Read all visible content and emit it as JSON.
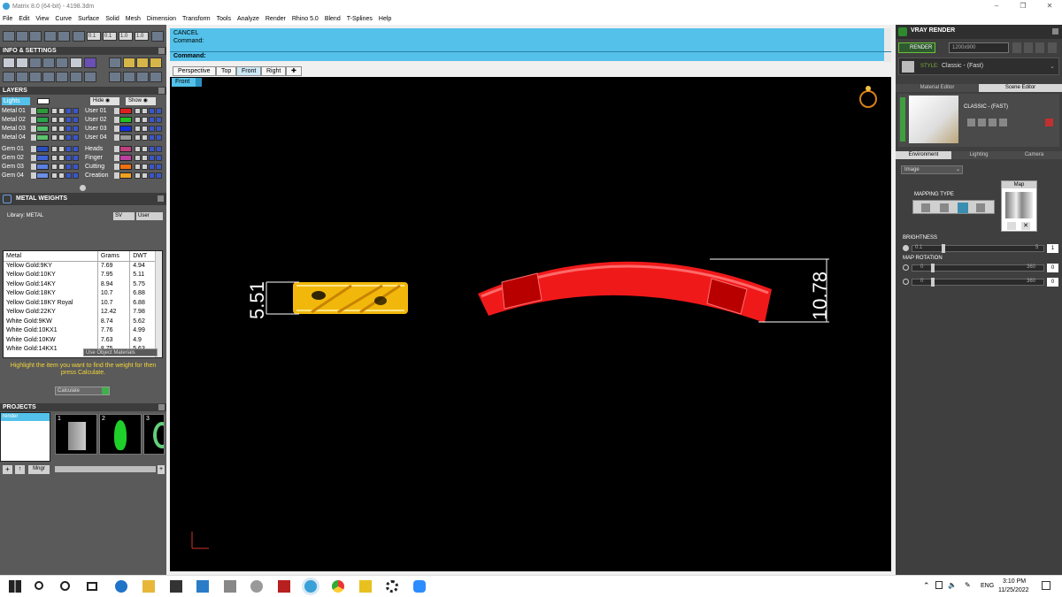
{
  "window": {
    "title": "Matrix 8.0 (64-bit) - 4198.3dm"
  },
  "menu": [
    "File",
    "Edit",
    "View",
    "Curve",
    "Surface",
    "Solid",
    "Mesh",
    "Dimension",
    "Transform",
    "Tools",
    "Analyze",
    "Render",
    "Rhino 5.0",
    "Blend",
    "T-Splines",
    "Help"
  ],
  "toolbar": {
    "values": [
      "0.1",
      "0.1",
      "1.0",
      "1.0"
    ]
  },
  "panels": {
    "info": "INFO & SETTINGS",
    "layers": "LAYERS",
    "metal_weights": "METAL WEIGHTS",
    "projects": "PROJECTS",
    "vray": "VRAY RENDER"
  },
  "layers": {
    "lights": "Lights",
    "hide": "Hide",
    "show": "Show",
    "left": [
      {
        "name": "Metal 01",
        "color": "#2f9a3a"
      },
      {
        "name": "Metal 02",
        "color": "#2aa24a"
      },
      {
        "name": "Metal 03",
        "color": "#52c06a"
      },
      {
        "name": "Metal 04",
        "color": "#5cc46e"
      },
      {
        "name": "Gem 01",
        "color": "#2a4ec0"
      },
      {
        "name": "Gem 02",
        "color": "#3e64d6"
      },
      {
        "name": "Gem 03",
        "color": "#5a80e0"
      },
      {
        "name": "Gem 04",
        "color": "#6d8fe4"
      }
    ],
    "right": [
      {
        "name": "User 01",
        "color": "#e02020"
      },
      {
        "name": "User 02",
        "color": "#22c022"
      },
      {
        "name": "User 03",
        "color": "#1030e0"
      },
      {
        "name": "User 04",
        "color": "#9a9a9a"
      },
      {
        "name": "Heads",
        "color": "#c04080"
      },
      {
        "name": "Finger",
        "color": "#c040a0"
      },
      {
        "name": "Cutting",
        "color": "#f07010"
      },
      {
        "name": "Creation",
        "color": "#f0a020"
      }
    ]
  },
  "metal_weights": {
    "library_label": "Library: METAL",
    "btn_sv": "SV",
    "btn_user": "User",
    "headers": [
      "Metal",
      "Grams",
      "DWT"
    ],
    "rows": [
      [
        "Yellow Gold:9KY",
        "7.69",
        "4.94"
      ],
      [
        "Yellow Gold:10KY",
        "7.95",
        "5.11"
      ],
      [
        "Yellow Gold:14KY",
        "8.94",
        "5.75"
      ],
      [
        "Yellow Gold:18KY",
        "10.7",
        "6.88"
      ],
      [
        "Yellow Gold:18KY Royal",
        "10.7",
        "6.88"
      ],
      [
        "Yellow Gold:22KY",
        "12.42",
        "7.98"
      ],
      [
        "White Gold:9KW",
        "8.74",
        "5.62"
      ],
      [
        "White Gold:10KX1",
        "7.76",
        "4.99"
      ],
      [
        "White Gold:10KW",
        "7.63",
        "4.9"
      ],
      [
        "White Gold:14KX1",
        "8.75",
        "5.63"
      ]
    ],
    "use_object": "Use Object Materials",
    "instructions": "Highlight the item you want to find the weight for then press Calculate.",
    "calculate": "Calculate"
  },
  "projects": {
    "item": "render",
    "numbers": [
      "1",
      "2",
      "3"
    ],
    "mngr": "Mngr"
  },
  "command": {
    "line1": "CANCEL",
    "line2": "Command:",
    "prompt": "Command:"
  },
  "viewtabs": [
    "Perspective",
    "Top",
    "Front",
    "Right"
  ],
  "viewport": {
    "label": "Front",
    "dim_left": "5.51",
    "dim_right": "10.78"
  },
  "vray": {
    "render_btn": "RENDER",
    "resolution": "1200x900",
    "style_label": "STYLE:",
    "style_value": "Classic - (Fast)",
    "tab_material": "Material Editor",
    "tab_scene": "Scene Editor",
    "preset": "CLASSIC - (FAST)",
    "env_tabs": [
      "Environment",
      "Lighting",
      "Camera"
    ],
    "image_select": "Image",
    "mapping_type": "MAPPING TYPE",
    "map": "Map",
    "brightness": "BRIGHTNESS",
    "brightness_min": "0.1",
    "brightness_max": "5",
    "brightness_val": "1",
    "map_rotation": "MAP ROTATION",
    "rot_min": "0",
    "rot_max": "360",
    "rot_val": "0"
  },
  "taskbar": {
    "lang": "ENG",
    "time": "3:10 PM",
    "date": "11/25/2022"
  }
}
